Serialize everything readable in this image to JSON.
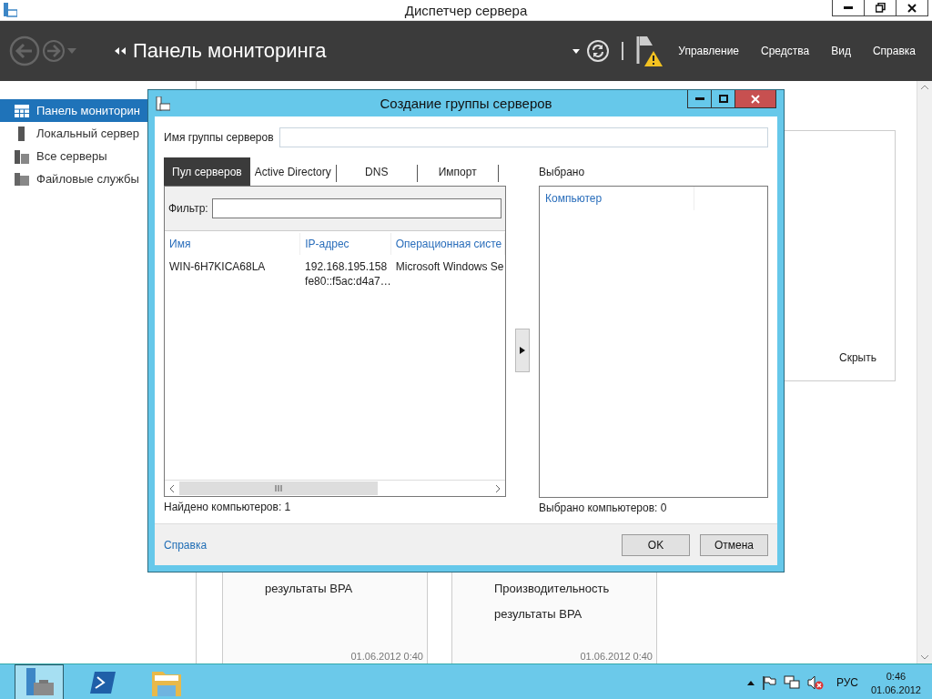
{
  "window": {
    "title": "Диспетчер сервера"
  },
  "header": {
    "title": "Панель мониторинга",
    "menu": [
      "Управление",
      "Средства",
      "Вид",
      "Справка"
    ]
  },
  "sidebar": {
    "items": [
      {
        "label": "Панель мониторин",
        "kind": "dashboard",
        "selected": true
      },
      {
        "label": "Локальный сервер",
        "kind": "server",
        "selected": false
      },
      {
        "label": "Все серверы",
        "kind": "servers",
        "selected": false
      },
      {
        "label": "Файловые службы",
        "kind": "files",
        "selected": false
      }
    ]
  },
  "welcome": {
    "hide_link": "Скрыть"
  },
  "cards": [
    {
      "lines": [
        "результаты BPA"
      ],
      "date": "01.06.2012 0:40"
    },
    {
      "lines": [
        "Производительность",
        "результаты BPA"
      ],
      "date": "01.06.2012 0:40"
    }
  ],
  "dialog": {
    "title": "Создание группы серверов",
    "name_label": "Имя группы серверов",
    "tabs": [
      {
        "label": "Пул серверов",
        "selected": true
      },
      {
        "label": "Active Directory",
        "selected": false
      },
      {
        "label": "DNS",
        "selected": false
      },
      {
        "label": "Импорт",
        "selected": false
      }
    ],
    "filter_label": "Фильтр:",
    "columns": [
      "Имя",
      "IP-адрес",
      "Операционная систе"
    ],
    "rows": [
      {
        "name": "WIN-6H7KICA68LA",
        "ip": [
          "192.168.195.158",
          "fe80::f5ac:d4a7…"
        ],
        "os": "Microsoft Windows Se"
      }
    ],
    "found": "Найдено компьютеров: 1",
    "selected_label": "Выбрано",
    "selected_columns": [
      "Компьютер"
    ],
    "selected_count": "Выбрано компьютеров: 0",
    "help_link": "Справка",
    "buttons": [
      "OK",
      "Отмена"
    ]
  },
  "taskbar": {
    "apps": [
      {
        "kind": "server-manager",
        "selected": true
      },
      {
        "kind": "powershell",
        "selected": false
      },
      {
        "kind": "explorer",
        "selected": false
      }
    ],
    "language": "РУС",
    "time": "0:46",
    "date": "01.06.2012"
  }
}
